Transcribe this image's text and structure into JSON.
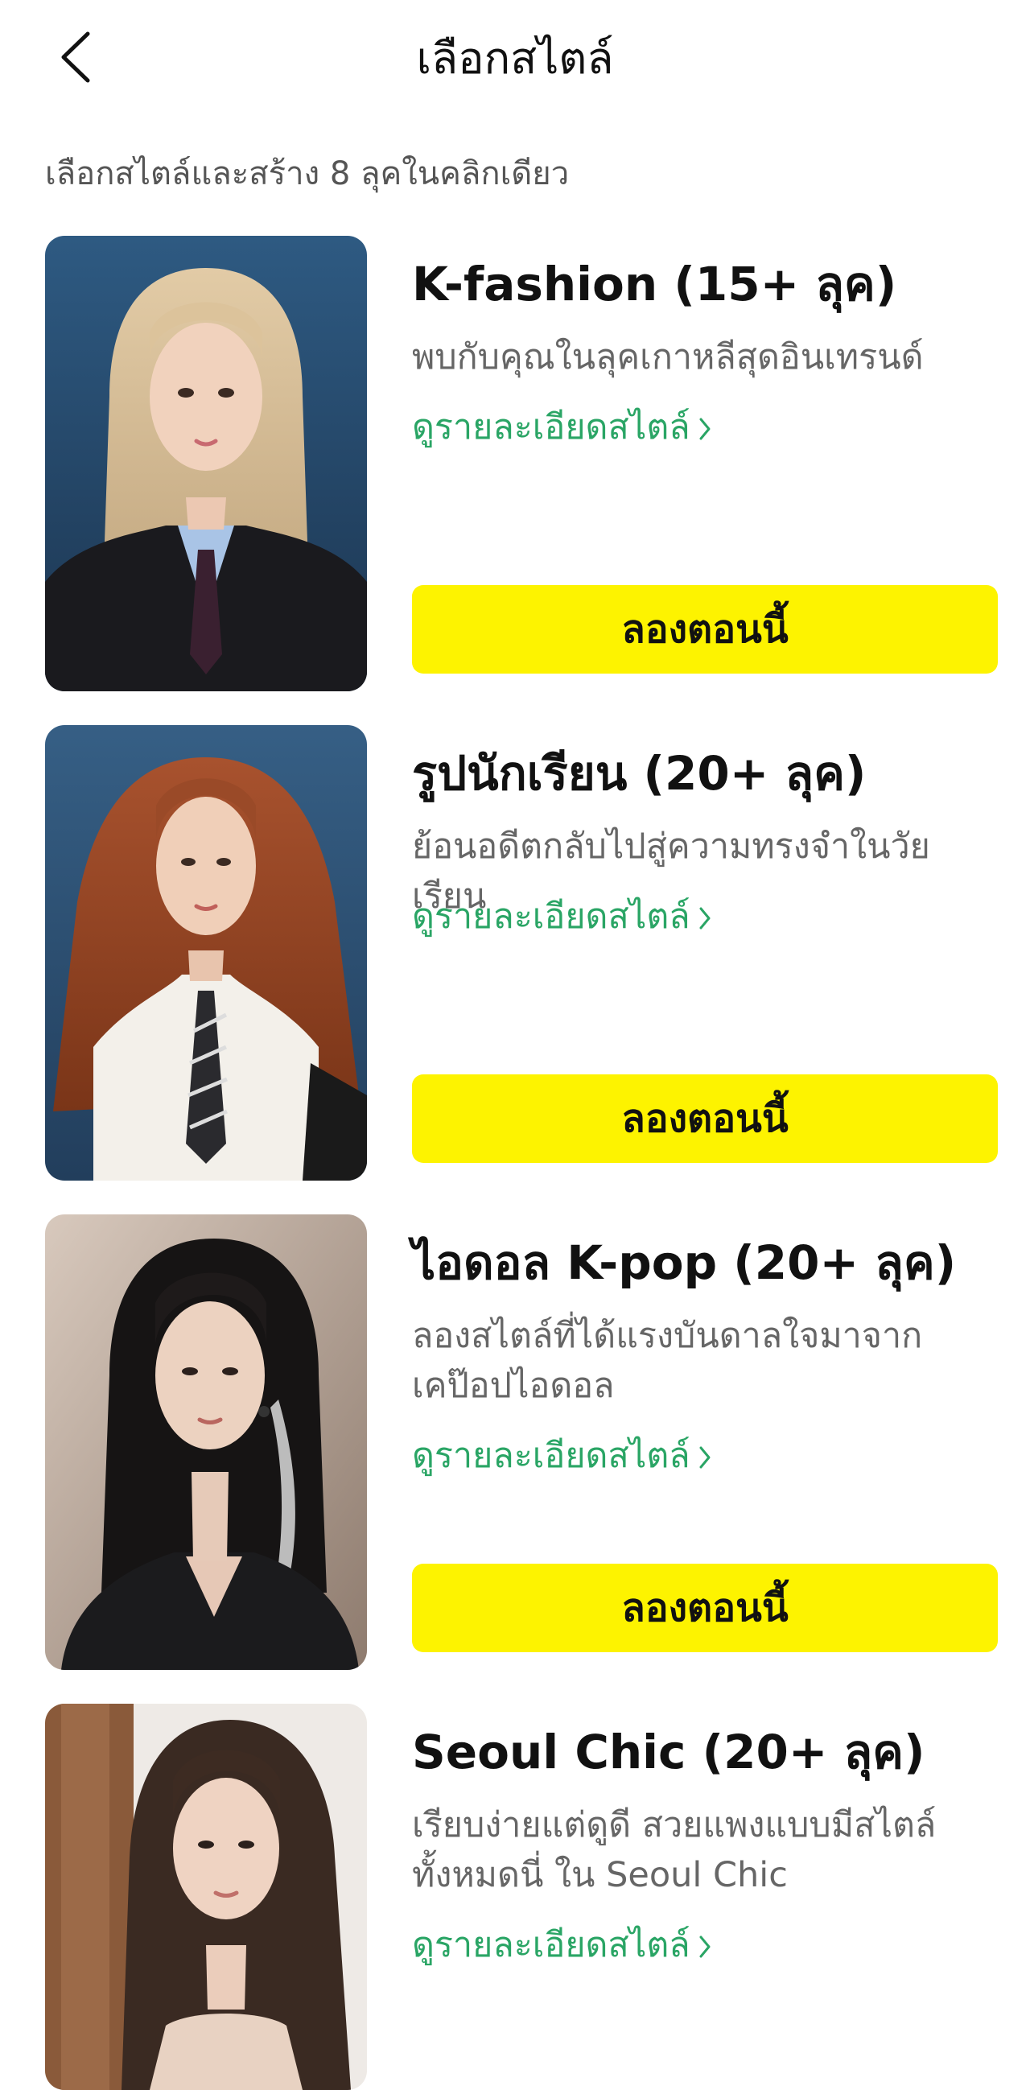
{
  "header": {
    "title": "เลือกสไตล์",
    "back_icon": "chevron-left-icon"
  },
  "subtitle": "เลือกสไตล์และสร้าง 8 ลุคในคลิกเดียว",
  "colors": {
    "accent_green": "#2aa565",
    "button_yellow": "#fdf300",
    "title_text": "#111111",
    "desc_text": "#666666"
  },
  "styles": [
    {
      "title": "K-fashion (15+ ลุค)",
      "description": "พบกับคุณในลุคเกาหลีสุดอินเทรนด์",
      "detail_link": "ดูรายละเอียดสไตล์",
      "button": "ลองตอนนี้"
    },
    {
      "title": "รูปนักเรียน (20+ ลุค)",
      "description": "ย้อนอดีตกลับไปสู่ความทรงจำในวัยเรียน",
      "detail_link": "ดูรายละเอียดสไตล์",
      "button": "ลองตอนนี้"
    },
    {
      "title": "ไอดอล K-pop (20+ ลุค)",
      "description": "ลองสไตล์ที่ได้แรงบันดาลใจมาจากเคป๊อปไอดอล",
      "detail_link": "ดูรายละเอียดสไตล์",
      "button": "ลองตอนนี้"
    },
    {
      "title": "Seoul Chic (20+ ลุค)",
      "description": "เรียบง่ายแต่ดูดี สวยแพงแบบมีสไตล์ทั้งหมดนี่ ใน Seoul Chic",
      "detail_link": "ดูรายละเอียดสไตล์"
    }
  ]
}
